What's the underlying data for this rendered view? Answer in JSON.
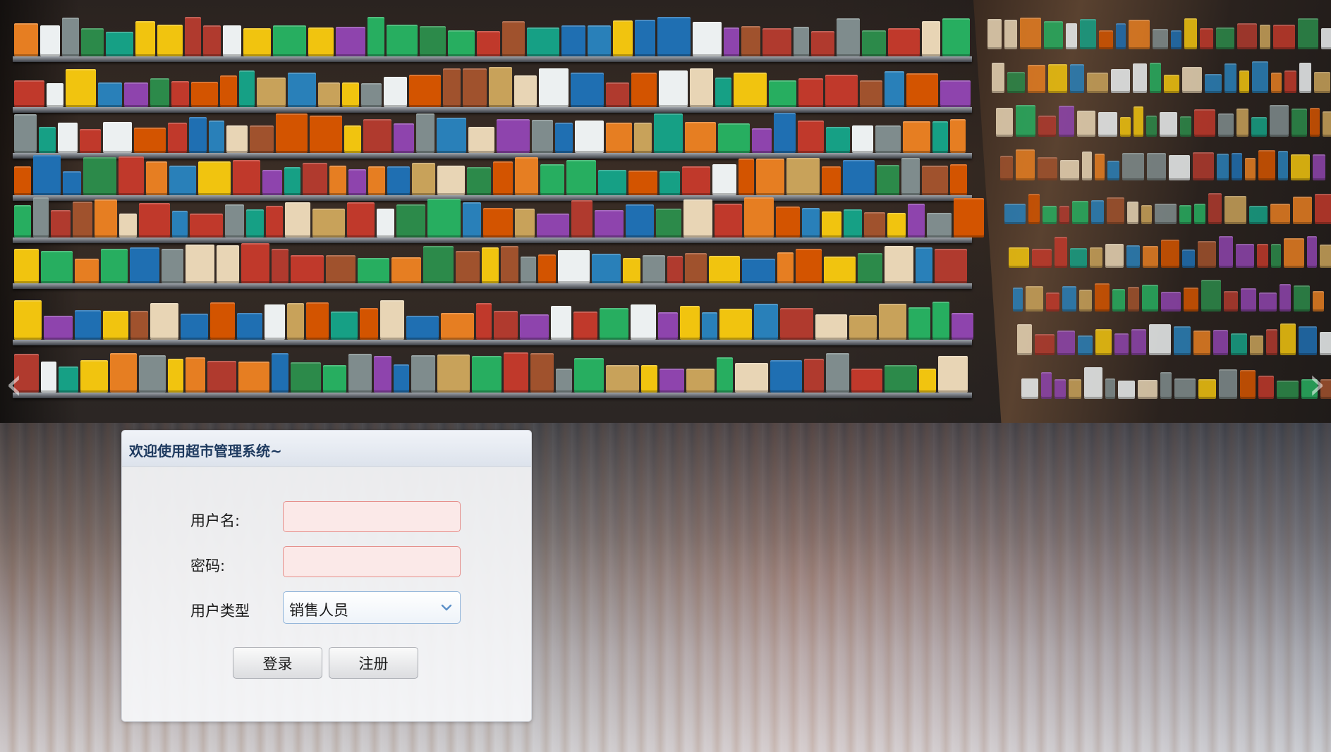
{
  "login": {
    "title": "欢迎使用超市管理系统~",
    "username_label": "用户名:",
    "username_value": "",
    "password_label": "密码:",
    "password_value": "",
    "user_type_label": "用户类型",
    "user_type_selected": "销售人员",
    "login_button": "登录",
    "register_button": "注册"
  },
  "colors": {
    "title_text": "#1e3a5f",
    "input_invalid_border": "#e58f8b",
    "input_invalid_bg": "#fbe9e8",
    "select_border": "#8fb3d9",
    "select_arrow": "#5b8fc7"
  },
  "icons": {
    "select_arrow": "chevron-down-icon",
    "background_nav_right": "chevron-right-icon",
    "background_nav_left": "chevron-left-icon"
  }
}
